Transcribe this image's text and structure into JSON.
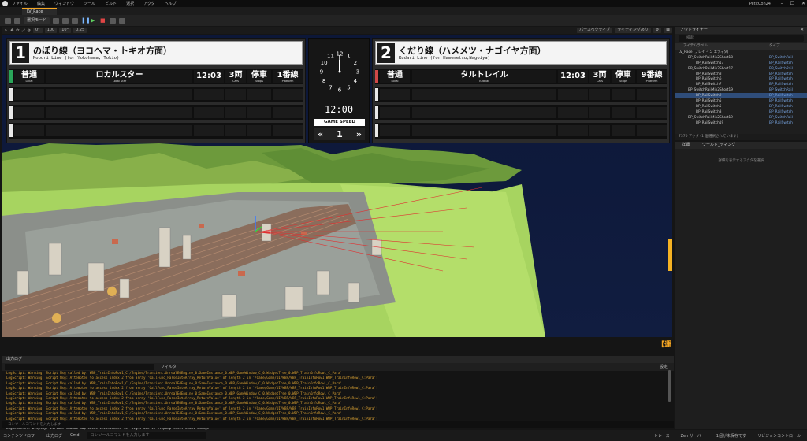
{
  "titlebar": {
    "menus": [
      "ファイル",
      "編集",
      "ウィンドウ",
      "ツール",
      "ビルド",
      "選択",
      "アクタ",
      "ヘルプ"
    ],
    "project": "PetitCon24"
  },
  "tab": {
    "label": "LV_Race"
  },
  "toolbar": {
    "mode": "選択モード"
  },
  "viewport_toolbar": {
    "values": [
      "0°",
      "100",
      "10°",
      "0.25"
    ],
    "perspective": "パースペクティブ",
    "lit": "ライティングあり"
  },
  "boards": {
    "left": {
      "number": "1",
      "title": "のぼり線（ヨコヘマ・トキオ方面）",
      "subtitle": "Nobori Line (for Yokohema, Tokio)",
      "train": {
        "type": "普通",
        "type_en": "Local",
        "dest": "ロカルスター",
        "dest_en": "Local Star",
        "time": "12:03",
        "cars": "3両",
        "cars_en": "Cars",
        "stops": "停車",
        "stops_en": "Stops",
        "platform": "1番線",
        "platform_en": "Platform"
      }
    },
    "right": {
      "number": "2",
      "title": "くだり線（ハメメツ・ナゴイヤ方面）",
      "subtitle": "Kudari Line (for Hamemetsu,Nagoiya)",
      "train": {
        "type": "普通",
        "type_en": "Local",
        "dest": "タルトレイル",
        "dest_en": "Tultelail",
        "time": "12:03",
        "cars": "3両",
        "cars_en": "Cars",
        "stops": "停車",
        "stops_en": "Stops",
        "platform": "9番線",
        "platform_en": "Platform"
      }
    },
    "clock": {
      "time": "12:00",
      "speed_label": "GAME SPEED",
      "speed": "1",
      "numerals": [
        "12",
        "1",
        "2",
        "3",
        "4",
        "5",
        "6",
        "7",
        "8",
        "9",
        "10",
        "11"
      ]
    }
  },
  "notification": "【運",
  "outliner": {
    "title": "アウトライナー",
    "search_placeholder": "検索",
    "col_label": "アイテムラベル",
    "col_type": "タイプ",
    "rows": [
      {
        "name": "LV_Race (プレイ イン エディタ)",
        "type": ""
      },
      {
        "name": "BP_SwitchRailMix2Short18",
        "type": "BP_SwitchRail"
      },
      {
        "name": "BP_RailSwitch17",
        "type": "BP_RailSwitch"
      },
      {
        "name": "BP_SwitchRailMix2Short17",
        "type": "BP_SwitchRail"
      },
      {
        "name": "BP_RailSwitch8",
        "type": "BP_RailSwitch"
      },
      {
        "name": "BP_RailSwitch6",
        "type": "BP_RailSwitch"
      },
      {
        "name": "BP_RailSwitch7",
        "type": "BP_RailSwitch"
      },
      {
        "name": "BP_SwitchRailMix2Short19",
        "type": "BP_SwitchRail"
      },
      {
        "name": "BP_RailSwitch9",
        "type": "BP_RailSwitch"
      },
      {
        "name": "BP_RailSwitch5",
        "type": "BP_RailSwitch"
      },
      {
        "name": "BP_RailSwitch5",
        "type": "BP_RailSwitch"
      },
      {
        "name": "BP_RailSwitch3",
        "type": "BP_RailSwitch"
      },
      {
        "name": "BP_SwitchRailMix2Short19",
        "type": "BP_SwitchRail"
      },
      {
        "name": "BP_RailSwitch19",
        "type": "BP_RailSwitch"
      }
    ],
    "footer": "7370 アクタ (1 個選択されています)"
  },
  "details": {
    "tabs": [
      "詳細",
      "ワールド_ティング"
    ],
    "empty": "詳細を表示するアクタを選択"
  },
  "log": {
    "title": "出力ログ",
    "filter": "フィルタ",
    "settings": "設定",
    "lines": [
      "LogScript: Warning: Script Msg called by: WBP_TrainInfoRow1_C /Engine/Transient.UnrealEdEngine_0:GameInstance_0.WBP_GameWindow_C_0.WidgetTree_0.WBP_TrainInfoRow1_C_Para'",
      "LogScript: Warning: Script Msg: Attempted to access index 2 from array 'CallFunc_ParseIntoArray_ReturnValue' of length 2 in '/Game/Game/UI/WBP/WBP_TrainInfoRow1.WBP_TrainInfoRow1_C:Para'!",
      "LogScript: Warning: Script Msg called by: WBP_TrainInfoRow1_C /Engine/Transient.UnrealEdEngine_0:GameInstance_0.WBP_GameWindow_C_0.WidgetTree_0.WBP_TrainInfoRow1_C_Para'",
      "LogScript: Warning: Script Msg: Attempted to access index 2 from array 'CallFunc_ParseIntoArray_ReturnValue' of length 2 in '/Game/Game/UI/WBP/WBP_TrainInfoRow1.WBP_TrainInfoRow1_C:Para'!",
      "LogScript: Warning: Script Msg called by: WBP_TrainInfoRow1_C /Engine/Transient.UnrealEdEngine_0:GameInstance_0.WBP_GameWindow_C_0.WidgetTree_0.WBP_TrainInfoRow1_C_Para'",
      "LogScript: Warning: Script Msg: Attempted to access index 2 from array 'CallFunc_ParseIntoArray_ReturnValue' of length 2 in '/Game/Game/UI/WBP/WBP_TrainInfoRow1.WBP_TrainInfoRow1_C:Para'!",
      "LogScript: Warning: Script Msg called by: WBP_TrainInfoRow1_C /Engine/Transient.UnrealEdEngine_0:GameInstance_0.WBP_GameWindow_C_0.WidgetTree_0.WBP_TrainInfoRow1_C_Para'",
      "LogScript: Warning: Script Msg: Attempted to access index 2 from array 'CallFunc_ParseIntoArray_ReturnValue' of length 2 in '/Game/Game/UI/WBP/WBP_TrainInfoRow1.WBP_TrainInfoRow1_C:Para'!",
      "LogScript: Warning: Script Msg called by: WBP_TrainInfoRow1_C /Engine/Transient.UnrealEdEngine_0:GameInstance_0.WBP_GameWindow_C_0.WidgetTree_0.WBP_TrainInfoRow1_C_Para'",
      "LogScript: Warning: Script Msg: Attempted to access index 2 from array 'CallFunc_ParseIntoArray_ReturnValue' of length 2 in '/Game/Game/UI/WBP/WBP_TrainInfoRow1.WBP_TrainInfoRow1_C:Para'!",
      "LogScript: Warning: Script Msg called by: WBP_TrainInfoRow1_C /Engine/Transient.UnrealEdEngine_0:GameInstance_0.WBP_GameWindow_C_0.WidgetTree_0.WBP_TrainInfoRow1_C_Para'",
      "LogRenderer: Display: Virtual shadow map cache invalidated for light due to clipmap level count change"
    ],
    "cmd_placeholder": "コンソールコマンドを入力します"
  },
  "statusbar": {
    "items": [
      "コンテンツドロワー",
      "出力ログ",
      "Cmd"
    ],
    "cmd_placeholder": "コンソールコマンドを入力します",
    "right": [
      "トレース",
      "Zen サーバー",
      "1個が未保存です",
      "リビジョンコントロール"
    ]
  }
}
